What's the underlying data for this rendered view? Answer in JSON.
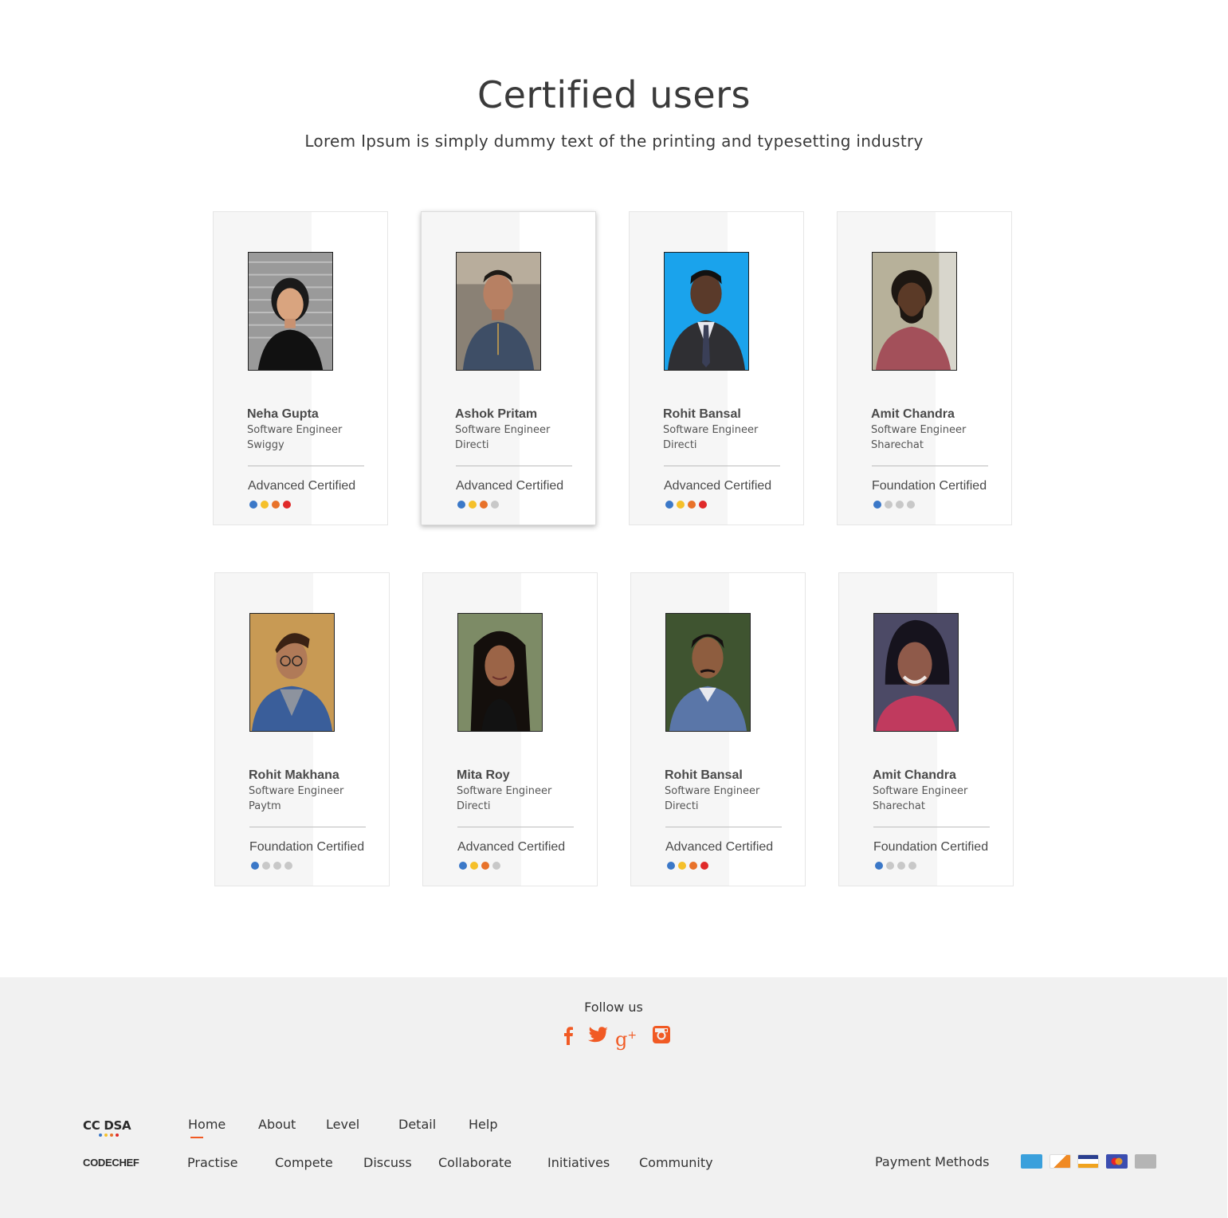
{
  "header": {
    "title": "Certified users",
    "subtitle": "Lorem Ipsum is simply dummy text of the printing and typesetting industry"
  },
  "users": [
    {
      "name": "Neha Gupta",
      "role": "Software Engineer",
      "company": "Swiggy",
      "cert": "Advanced Certified",
      "level": 4
    },
    {
      "name": "Ashok Pritam",
      "role": "Software Engineer",
      "company": "Directi",
      "cert": "Advanced Certified",
      "level": 3
    },
    {
      "name": "Rohit Bansal",
      "role": "Software Engineer",
      "company": "Directi",
      "cert": "Advanced Certified",
      "level": 4
    },
    {
      "name": "Amit Chandra",
      "role": "Software Engineer",
      "company": "Sharechat",
      "cert": "Foundation Certified",
      "level": 1
    },
    {
      "name": "Rohit Makhana",
      "role": "Software Engineer",
      "company": "Paytm",
      "cert": "Foundation Certified",
      "level": 1
    },
    {
      "name": "Mita Roy",
      "role": "Software Engineer",
      "company": "Directi",
      "cert": "Advanced Certified",
      "level": 3
    },
    {
      "name": "Rohit Bansal",
      "role": "Software Engineer",
      "company": "Directi",
      "cert": "Advanced Certified",
      "level": 4
    },
    {
      "name": "Amit Chandra",
      "role": "Software Engineer",
      "company": "Sharechat",
      "cert": "Foundation Certified",
      "level": 1
    }
  ],
  "level_colors": [
    "#3b78c8",
    "#f5c02a",
    "#e8722a",
    "#e02a2a"
  ],
  "inactive_dot_color": "#c8c8c8",
  "footer": {
    "follow_label": "Follow us",
    "social": [
      "facebook-icon",
      "twitter-icon",
      "google-plus-icon",
      "instagram-icon"
    ],
    "logo_top": "CC DSA",
    "logo_bottom": "CODECHEF",
    "nav_primary": [
      "Home",
      "About",
      "Level",
      "Detail",
      "Help"
    ],
    "nav_secondary": [
      "Practise",
      "Compete",
      "Discuss",
      "Collaborate",
      "Initiatives",
      "Community"
    ],
    "payment_label": "Payment Methods",
    "payment_icons": [
      "amex-icon",
      "discover-icon",
      "visa-icon",
      "mastercard-icon",
      "generic-card-icon"
    ]
  },
  "accent_color": "#f15a24"
}
